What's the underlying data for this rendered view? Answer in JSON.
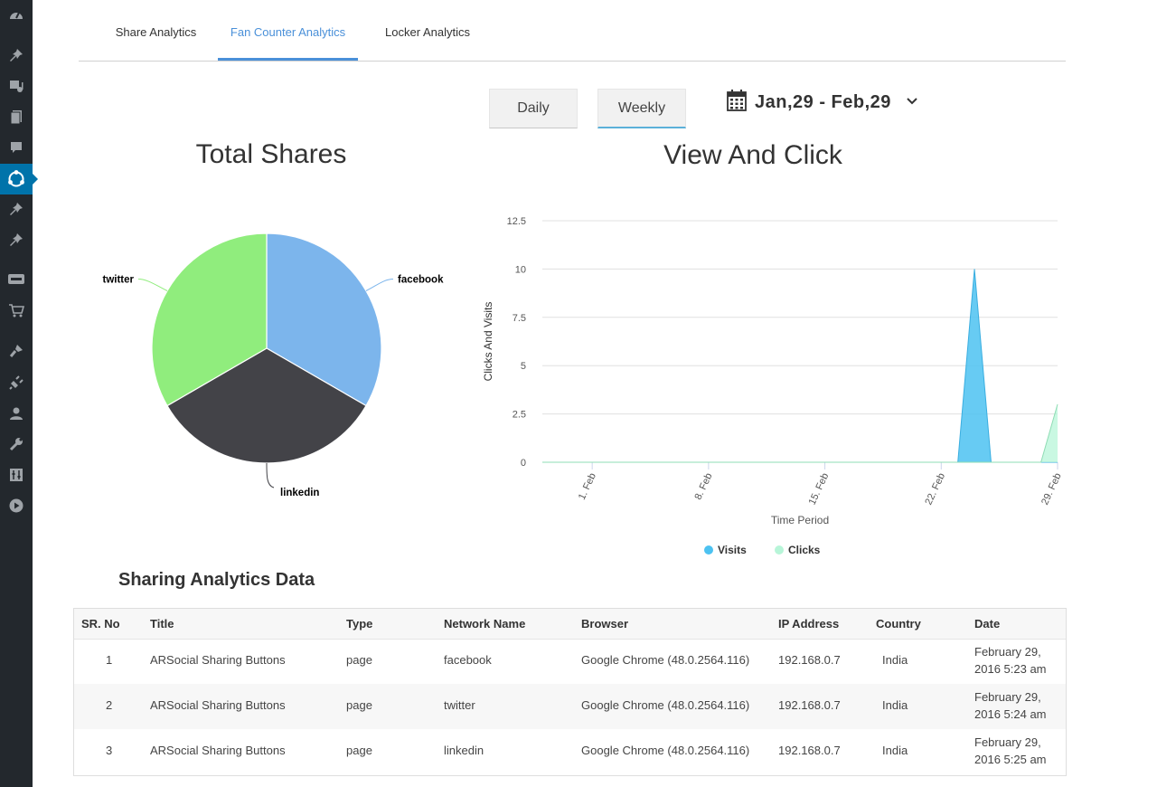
{
  "tabs": [
    {
      "label": "Share Analytics",
      "active": false
    },
    {
      "label": "Fan Counter Analytics",
      "active": true
    },
    {
      "label": "Locker Analytics",
      "active": false
    }
  ],
  "period_buttons": {
    "daily": "Daily",
    "weekly": "Weekly"
  },
  "date_range": {
    "label": "Jan,29 - Feb,29",
    "icon": "calendar-icon",
    "dropdown_icon": "chevron-down-icon"
  },
  "sidebar": {
    "icons": [
      "dashboard-icon",
      "pin-icon",
      "media-icon",
      "pages-icon",
      "comments-icon",
      "arsocial-icon",
      "pin-icon",
      "pin-icon",
      "woo-icon",
      "cart-icon",
      "appearance-icon",
      "plugins-icon",
      "users-icon",
      "tools-icon",
      "settings-icon",
      "play-icon"
    ],
    "active_index": 5
  },
  "total_shares": {
    "title": "Total Shares",
    "chart_data": {
      "type": "pie",
      "slices": [
        {
          "label": "facebook",
          "value": 1,
          "color": "#7cb5ec"
        },
        {
          "label": "linkedin",
          "value": 1,
          "color": "#434348"
        },
        {
          "label": "twitter",
          "value": 1,
          "color": "#90ed7d"
        }
      ]
    }
  },
  "view_click": {
    "title": "View And Click",
    "chart_data": {
      "type": "area",
      "xlabel": "Time Period",
      "ylabel": "Clicks And Visits",
      "x_ticks": [
        "1. Feb",
        "8. Feb",
        "15. Feb",
        "22. Feb",
        "29. Feb"
      ],
      "y_ticks": [
        "0",
        "2.5",
        "5",
        "7.5",
        "10",
        "12.5"
      ],
      "ylim": [
        0,
        12.5
      ],
      "x_dates": [
        "Jan 29",
        "Jan 30",
        "Jan 31",
        "Feb 1",
        "Feb 2",
        "Feb 3",
        "Feb 4",
        "Feb 5",
        "Feb 6",
        "Feb 7",
        "Feb 8",
        "Feb 9",
        "Feb 10",
        "Feb 11",
        "Feb 12",
        "Feb 13",
        "Feb 14",
        "Feb 15",
        "Feb 16",
        "Feb 17",
        "Feb 18",
        "Feb 19",
        "Feb 20",
        "Feb 21",
        "Feb 22",
        "Feb 23",
        "Feb 24",
        "Feb 25",
        "Feb 26",
        "Feb 27",
        "Feb 28",
        "Feb 29"
      ],
      "series": [
        {
          "name": "Visits",
          "color": "#4cc2f1",
          "values": [
            0,
            0,
            0,
            0,
            0,
            0,
            0,
            0,
            0,
            0,
            0,
            0,
            0,
            0,
            0,
            0,
            0,
            0,
            0,
            0,
            0,
            0,
            0,
            0,
            0,
            0,
            10,
            0,
            0,
            0,
            0,
            0
          ]
        },
        {
          "name": "Clicks",
          "color": "#b7f5d8",
          "values": [
            0,
            0,
            0,
            0,
            0,
            0,
            0,
            0,
            0,
            0,
            0,
            0,
            0,
            0,
            0,
            0,
            0,
            0,
            0,
            0,
            0,
            0,
            0,
            0,
            0,
            0,
            0,
            0,
            0,
            0,
            0,
            3
          ]
        }
      ],
      "legend_position": "bottom-center"
    }
  },
  "table": {
    "title": "Sharing Analytics Data",
    "headers": [
      "SR. No",
      "Title",
      "Type",
      "Network Name",
      "Browser",
      "IP Address",
      "Country",
      "Date"
    ],
    "rows": [
      {
        "sr": "1",
        "title": "ARSocial Sharing Buttons",
        "type": "page",
        "network": "facebook",
        "browser": "Google Chrome (48.0.2564.116)",
        "ip": "192.168.0.7",
        "country": "India",
        "date": "February 29, 2016 5:23 am"
      },
      {
        "sr": "2",
        "title": "ARSocial Sharing Buttons",
        "type": "page",
        "network": "twitter",
        "browser": "Google Chrome (48.0.2564.116)",
        "ip": "192.168.0.7",
        "country": "India",
        "date": "February 29, 2016 5:24 am"
      },
      {
        "sr": "3",
        "title": "ARSocial Sharing Buttons",
        "type": "page",
        "network": "linkedin",
        "browser": "Google Chrome (48.0.2564.116)",
        "ip": "192.168.0.7",
        "country": "India",
        "date": "February 29, 2016 5:25 am"
      }
    ]
  }
}
